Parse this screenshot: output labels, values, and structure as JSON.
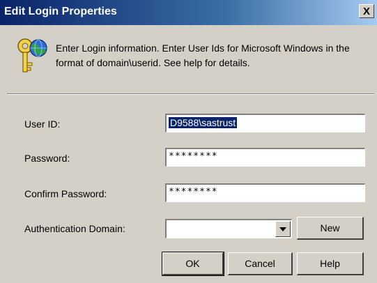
{
  "dialog": {
    "title": "Edit Login Properties",
    "close_label": "X",
    "intro": "Enter Login information. Enter User Ids for Microsoft Windows in the format of domain\\userid. See help for details."
  },
  "form": {
    "user_id_label": "User ID:",
    "user_id_value": "D9588\\sastrust",
    "password_label": "Password:",
    "password_value": "********",
    "confirm_label": "Confirm Password:",
    "confirm_value": "********",
    "domain_label": "Authentication Domain:",
    "domain_value": ""
  },
  "buttons": {
    "new": "New",
    "ok": "OK",
    "cancel": "Cancel",
    "help": "Help"
  },
  "icons": {
    "keys": "keys-globe-icon",
    "dropdown": "chevron-down-icon"
  },
  "colors": {
    "titlebar_start": "#0a246a",
    "titlebar_end": "#a6caf0",
    "face": "#d4d0c8",
    "selection": "#0a246a"
  }
}
